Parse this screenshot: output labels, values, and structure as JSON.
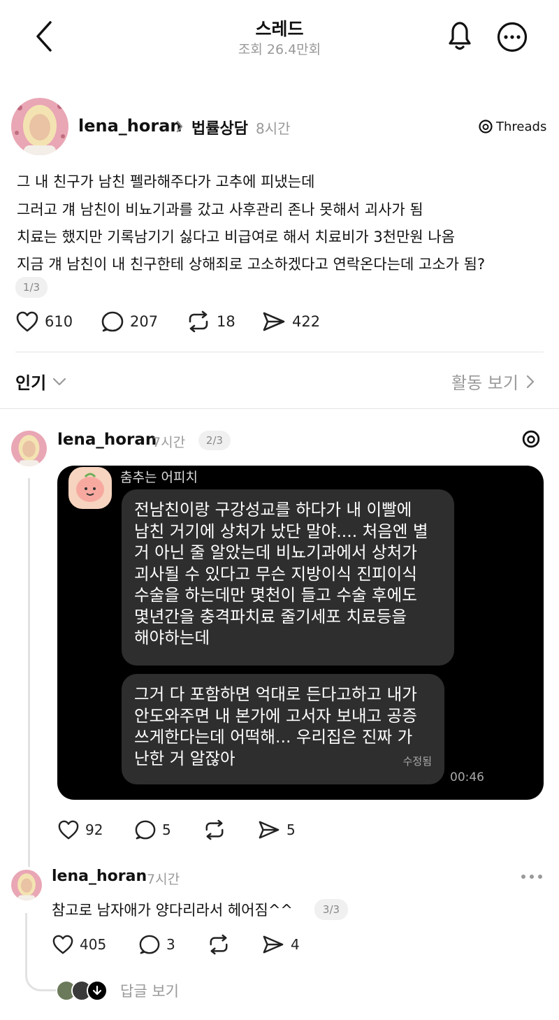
{
  "header": {
    "title": "스레드",
    "views": "조회 26.4만회"
  },
  "main_post": {
    "username": "lena_horan",
    "community": "법률상담",
    "time": "8시간",
    "brand": "Threads",
    "lines": [
      "그 내 친구가 남친 펠라해주다가 고추에 피냈는데",
      "그러고 걔 남친이 비뇨기과를 갔고 사후관리 존나 못해서 괴사가 됨",
      "치료는 했지만 기록남기기 싫다고 비급여로 해서 치료비가 3천만원 나옴",
      "지금 걔 남친이 내 친구한테 상해죄로 고소하겠다고 연락온다는데 고소가 됨?"
    ],
    "page_badge": "1/3",
    "likes": "610",
    "comments": "207",
    "reposts": "18",
    "shares": "422"
  },
  "sort_bar": {
    "label": "인기",
    "activity": "활동 보기"
  },
  "reply1": {
    "username": "lena_horan",
    "time": "7시간",
    "page_badge": "2/3",
    "likes": "92",
    "comments": "5",
    "shares": "5",
    "chat": {
      "sender": "춤추는 어피치",
      "bubble1": [
        "전남친이랑 구강성교를 하다가 내 이빨에",
        "남친 거기에 상처가 났단 말야.... 처음엔 별",
        "거 아닌 줄 알았는데 비뇨기과에서 상처가",
        "괴사될 수 있다고 무슨 지방이식 진피이식",
        "수술을 하는데만 몇천이 들고 수술 후에도",
        "몇년간을 충격파치료 줄기세포 치료등을",
        "해야하는데"
      ],
      "bubble2": [
        "그거 다 포함하면 억대로 든다고하고 내가",
        "안도와주면 내 본가에 고서자 보내고 공증",
        "쓰게한다는데 어떡해... 우리집은 진짜 가",
        "난한 거 알잖아"
      ],
      "edited": "수정됨",
      "timestamp": "00:46"
    }
  },
  "reply2": {
    "username": "lena_horan",
    "time": "7시간",
    "text": "참고로 남자애가 양다리라서 헤어짐^^",
    "page_badge": "3/3",
    "likes": "405",
    "comments": "3",
    "shares": "4"
  },
  "see_replies": "답글 보기"
}
